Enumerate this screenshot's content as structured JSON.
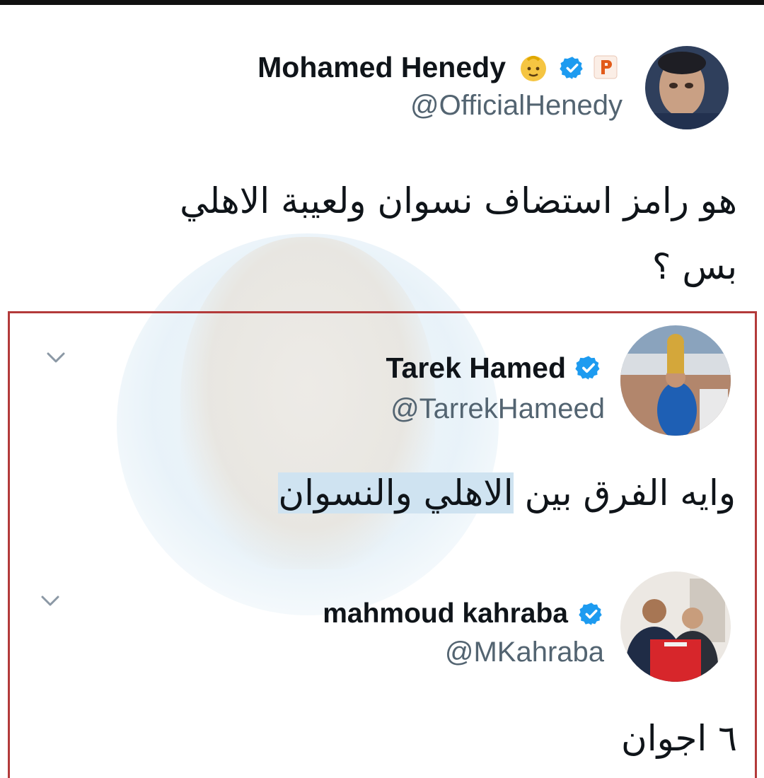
{
  "tweet": {
    "author_name": "Mohamed Henedy",
    "author_handle": "@OfficialHenedy",
    "emoji_badge": "👶",
    "text_line1": "هو رامز استضاف نسوان ولعيبة الاهلي",
    "text_line2": "بس ؟"
  },
  "replies": [
    {
      "author_name": "Tarek Hamed",
      "author_handle": "@TarrekHameed",
      "text_plain": "وايه الفرق بين ",
      "text_highlight": "الاهلي والنسوان"
    },
    {
      "author_name": "mahmoud kahraba",
      "author_handle": "@MKahraba",
      "text": "٦ اجوان"
    }
  ],
  "icons": {
    "verified": "verified-badge-icon",
    "more": "chevron-down-icon",
    "affiliate": "affiliate-badge-icon"
  },
  "colors": {
    "verified_blue": "#1d9bf0",
    "name_text": "#0f1419",
    "handle_text": "#536471",
    "quote_border": "#b33a3a",
    "highlight": "#cfe3f1"
  }
}
